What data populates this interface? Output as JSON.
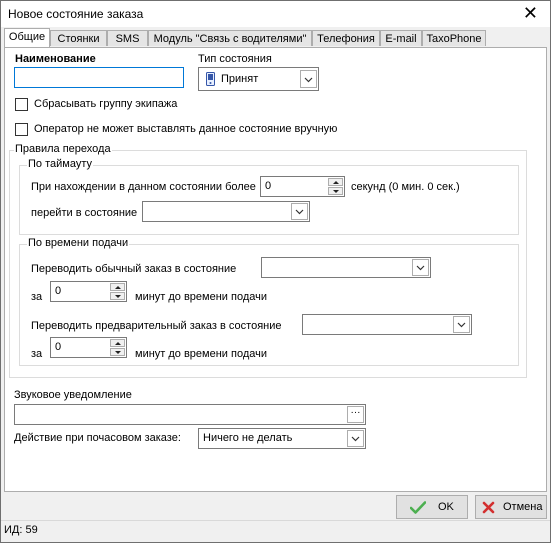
{
  "window": {
    "title": "Новое состояние заказа",
    "close_glyph": "✕"
  },
  "tabs": [
    {
      "label": "Общие",
      "active": true
    },
    {
      "label": "Стоянки"
    },
    {
      "label": "SMS"
    },
    {
      "label": "Модуль \"Связь с водителями\""
    },
    {
      "label": "Телефония"
    },
    {
      "label": "E-mail"
    },
    {
      "label": "TaxoPhone"
    }
  ],
  "general": {
    "name_label": "Наименование",
    "name_value": "",
    "state_type_label": "Тип состояния",
    "state_type_value": "Принят",
    "reset_crew_group_label": "Сбрасывать группу экипажа",
    "reset_crew_group_checked": false,
    "operator_cannot_set_label": "Оператор не может выставлять данное состояние вручную",
    "operator_cannot_set_checked": false
  },
  "transition_rules": {
    "title": "Правила перехода",
    "timeout": {
      "title": "По таймауту",
      "when_in_state_label": "При нахождении в данном состоянии более",
      "seconds_value": "0",
      "seconds_suffix": "секунд  (0 мин. 0 сек.)",
      "goto_state_label": "перейти в состояние",
      "goto_state_value": ""
    },
    "by_pickup_time": {
      "title": "По времени подачи",
      "regular_label": "Переводить обычный заказ в состояние",
      "regular_value": "",
      "regular_prefix": "за",
      "regular_minutes": "0",
      "regular_suffix": "минут до времени подачи",
      "preliminary_label": "Переводить предварительный заказ в состояние",
      "preliminary_value": "",
      "preliminary_prefix": "за",
      "preliminary_minutes": "0",
      "preliminary_suffix": "минут до времени подачи"
    }
  },
  "sound": {
    "label": "Звуковое уведомление",
    "value": "",
    "browse_label": "···"
  },
  "hourly": {
    "label": "Действие при почасовом заказе:",
    "value": "Ничего не делать"
  },
  "buttons": {
    "ok": "OK",
    "cancel": "Отмена"
  },
  "status": {
    "id_text": "ИД: 59"
  },
  "colors": {
    "ok_check": "#4caf50",
    "cancel_x": "#d32f2f",
    "focus_border": "#0078d7"
  }
}
